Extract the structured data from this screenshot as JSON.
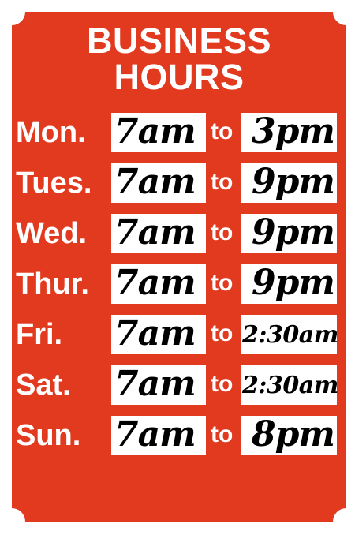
{
  "sign": {
    "title_line1": "BUSINESS",
    "title_line2": "HOURS",
    "background_color": "#e23a1f",
    "separator": "to",
    "days": [
      {
        "day": "Mon.",
        "open": "7am",
        "close": "3pm"
      },
      {
        "day": "Tues.",
        "open": "7am",
        "close": "9pm"
      },
      {
        "day": "Wed.",
        "open": "7am",
        "close": "9pm"
      },
      {
        "day": "Thur.",
        "open": "7am",
        "close": "9pm"
      },
      {
        "day": "Fri.",
        "open": "7am",
        "close": "2:30am"
      },
      {
        "day": "Sat.",
        "open": "7am",
        "close": "2:30am"
      },
      {
        "day": "Sun.",
        "open": "7am",
        "close": "8pm"
      }
    ]
  }
}
